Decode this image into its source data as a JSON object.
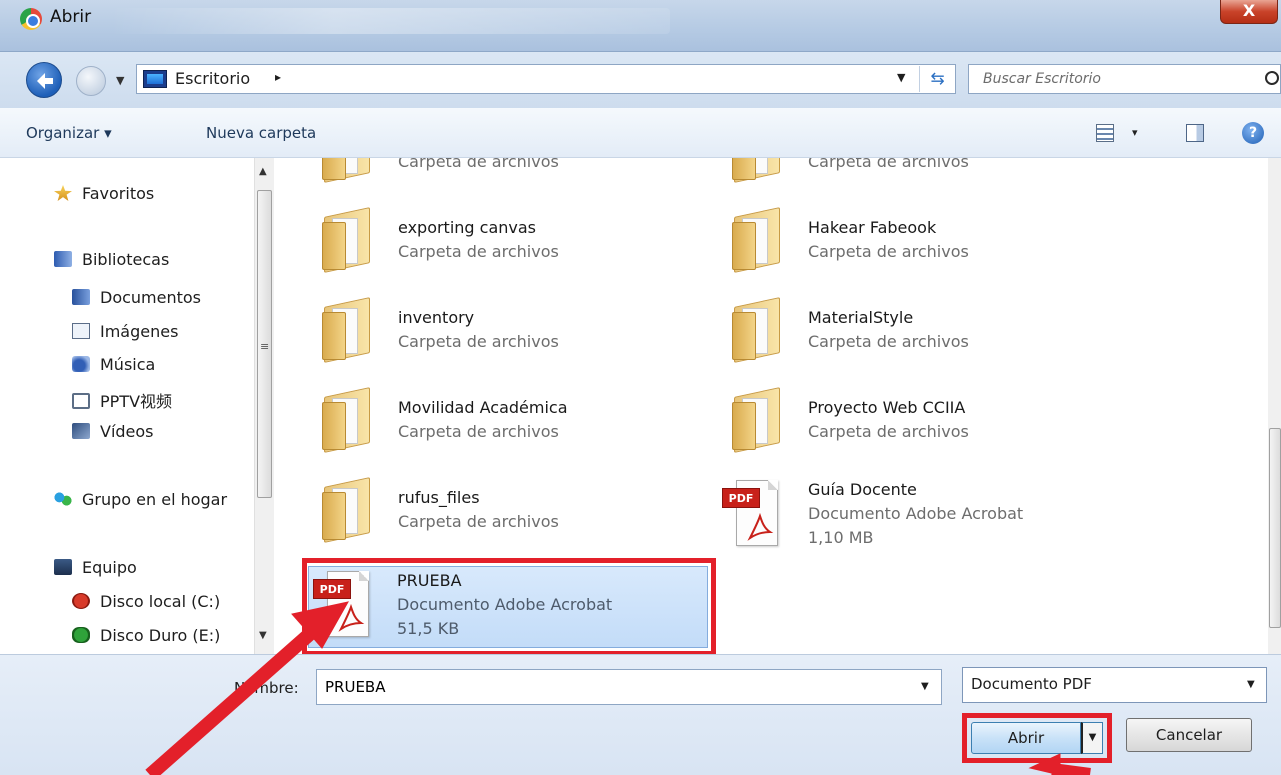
{
  "window": {
    "title": "Abrir",
    "close_glyph": "X"
  },
  "navigation": {
    "breadcrumb": "Escritorio",
    "breadcrumb_sep": "▸",
    "search_placeholder": "Buscar Escritorio"
  },
  "toolbar": {
    "organize": "Organizar ▾",
    "new_folder": "Nueva carpeta",
    "view_menu_glyph": "▾"
  },
  "sidebar": {
    "favorites": "Favoritos",
    "libraries": "Bibliotecas",
    "library_items": [
      "Documentos",
      "Imágenes",
      "Música",
      "PPTV视频",
      "Vídeos"
    ],
    "homegroup": "Grupo en el hogar",
    "computer": "Equipo",
    "drives": [
      "Disco local (C:)",
      "Disco Duro (E:)"
    ]
  },
  "files": [
    {
      "name": "",
      "type": "Carpeta de archivos",
      "icon": "folder-icon"
    },
    {
      "name": "",
      "type": "Carpeta de archivos",
      "icon": "folder-icon"
    },
    {
      "name": "exporting canvas",
      "type": "Carpeta de archivos",
      "icon": "folder-icon"
    },
    {
      "name": "Hakear Fabeook",
      "type": "Carpeta de archivos",
      "icon": "folder-icon"
    },
    {
      "name": "inventory",
      "type": "Carpeta de archivos",
      "icon": "folder-icon"
    },
    {
      "name": "MaterialStyle",
      "type": "Carpeta de archivos",
      "icon": "folder-icon"
    },
    {
      "name": "Movilidad Académica",
      "type": "Carpeta de archivos",
      "icon": "folder-icon"
    },
    {
      "name": "Proyecto Web CCIIA",
      "type": "Carpeta de archivos",
      "icon": "folder-icon"
    },
    {
      "name": "rufus_files",
      "type": "Carpeta de archivos",
      "icon": "folder-icon"
    },
    {
      "name": "Guía Docente",
      "type": "Documento Adobe Acrobat",
      "size": "1,10 MB",
      "icon": "pdf-icon"
    },
    {
      "name": "PRUEBA",
      "type": "Documento Adobe Acrobat",
      "size": "51,5 KB",
      "icon": "pdf-icon",
      "selected": true
    }
  ],
  "pdf_tag": "PDF",
  "footer": {
    "name_label": "Nombre:",
    "name_value": "PRUEBA",
    "filter_value": "Documento PDF",
    "open_label": "Abrir",
    "cancel_label": "Cancelar"
  },
  "colors": {
    "annotation": "#e3202a",
    "selection": "#c3dcf8"
  }
}
